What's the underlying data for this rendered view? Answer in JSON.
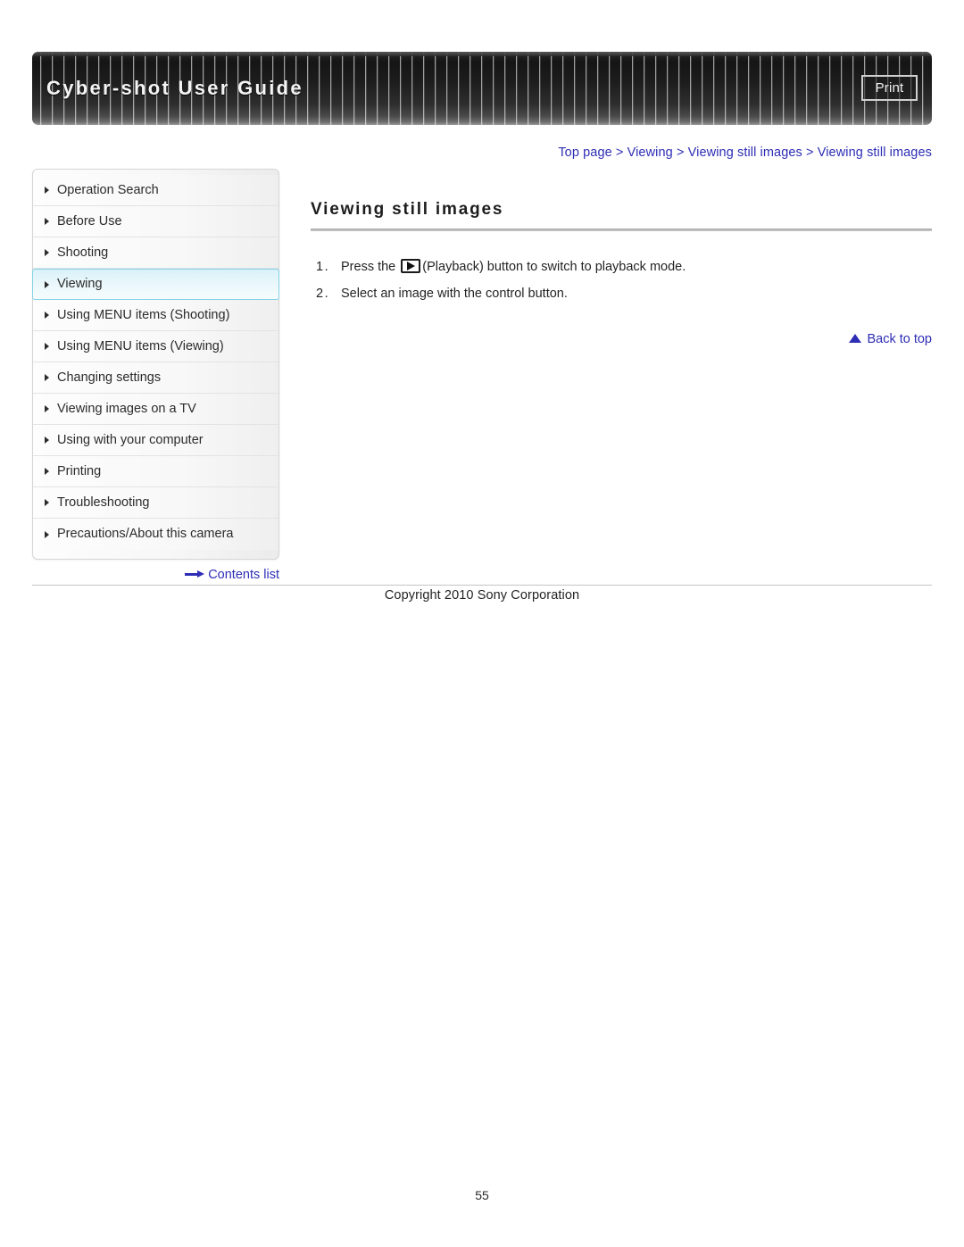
{
  "header": {
    "title": "Cyber-shot User Guide",
    "print_label": "Print"
  },
  "breadcrumb": {
    "text": "Top page > Viewing > Viewing still images > Viewing still images",
    "segments": [
      "Top page",
      "Viewing",
      "Viewing still images",
      "Viewing still images"
    ],
    "separator": ">"
  },
  "sidebar": {
    "items": [
      {
        "label": "Operation Search",
        "active": false
      },
      {
        "label": "Before Use",
        "active": false
      },
      {
        "label": "Shooting",
        "active": false
      },
      {
        "label": "Viewing",
        "active": true
      },
      {
        "label": "Using MENU items (Shooting)",
        "active": false
      },
      {
        "label": "Using MENU items (Viewing)",
        "active": false
      },
      {
        "label": "Changing settings",
        "active": false
      },
      {
        "label": "Viewing images on a TV",
        "active": false
      },
      {
        "label": "Using with your computer",
        "active": false
      },
      {
        "label": "Printing",
        "active": false
      },
      {
        "label": "Troubleshooting",
        "active": false
      },
      {
        "label": "Precautions/About this camera",
        "active": false
      }
    ],
    "contents_list_label": "Contents list"
  },
  "main": {
    "heading": "Viewing still images",
    "steps": [
      {
        "number": "1.",
        "text_before_icon": "Press the",
        "icon": "playback-icon",
        "text_after_icon": "(Playback) button to switch to playback mode."
      },
      {
        "number": "2.",
        "text_before_icon": "Select an image with the control button.",
        "icon": null,
        "text_after_icon": ""
      }
    ],
    "back_to_top_label": "Back to top"
  },
  "footer": {
    "copyright": "Copyright 2010 Sony Corporation",
    "page_number": "55"
  },
  "colors": {
    "link": "#2d2db5",
    "active_item_border": "#84d2e6",
    "active_item_bg": "#e9f7fb",
    "header_dark": "#1d1d1d",
    "rule": "#c4c4c4"
  }
}
